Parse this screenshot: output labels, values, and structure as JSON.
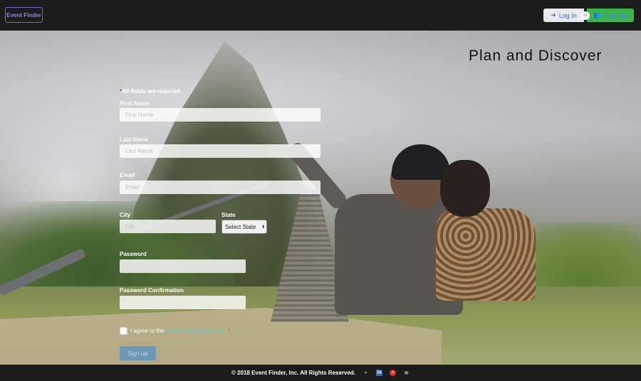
{
  "navbar": {
    "brand": "Event Finder",
    "login_label": "Log In",
    "or_label": "or",
    "signup_label": "Sign Up"
  },
  "hero": {
    "tagline": "Plan and Discover"
  },
  "form": {
    "required_note": "All fields are requried",
    "first_name": {
      "label": "First Name",
      "placeholder": "First Name"
    },
    "last_name": {
      "label": "Last Name",
      "placeholder": "Last Name"
    },
    "email": {
      "label": "Email",
      "placeholder": "Email"
    },
    "city": {
      "label": "City",
      "placeholder": "City"
    },
    "state": {
      "label": "State",
      "selected": "Select State"
    },
    "password": {
      "label": "Password"
    },
    "password_confirmation": {
      "label": "Password Confirmation"
    },
    "agree_prefix": "I agree to the",
    "terms_link": "Terms and Conditions",
    "submit_label": "Sign Up"
  },
  "footer": {
    "copyright": "© 2018 Event Finder, Inc. All Rights Reserved.",
    "icons": [
      "github-icon",
      "linkedin-icon",
      "circle-icon",
      "mail-icon"
    ]
  },
  "colors": {
    "brand_border": "#6f6fd6",
    "signup_green": "#3cb64a",
    "terms_link": "#3fd6e0",
    "submit_blue": "#6c98b6"
  }
}
